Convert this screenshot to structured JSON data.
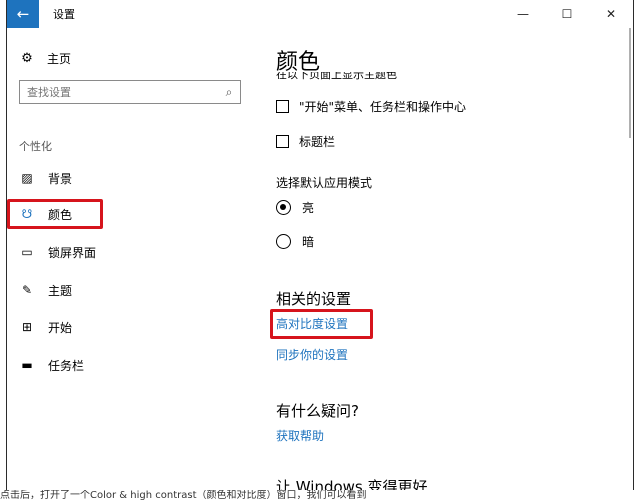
{
  "window": {
    "title": "设置",
    "back_icon": "arrow-left-icon",
    "controls": [
      "—",
      "☐",
      "✕"
    ]
  },
  "sidebar": {
    "home": {
      "label": "主页",
      "icon": "gear-icon"
    },
    "search": {
      "placeholder": "查找设置",
      "icon": "search-icon"
    },
    "section_label": "个性化",
    "items": [
      {
        "label": "背景",
        "icon": "picture-icon"
      },
      {
        "label": "颜色",
        "icon": "palette-icon",
        "active": true
      },
      {
        "label": "锁屏界面",
        "icon": "lock-screen-icon"
      },
      {
        "label": "主题",
        "icon": "theme-brush-icon"
      },
      {
        "label": "开始",
        "icon": "start-grid-icon"
      },
      {
        "label": "任务栏",
        "icon": "taskbar-icon"
      }
    ]
  },
  "main": {
    "title": "颜色",
    "clipped_text": "在以下页面上显示主题色",
    "checkboxes": [
      {
        "label": "\"开始\"菜单、任务栏和操作中心",
        "checked": false
      },
      {
        "label": "标题栏",
        "checked": false
      }
    ],
    "app_mode_heading": "选择默认应用模式",
    "app_modes": [
      {
        "label": "亮",
        "checked": true
      },
      {
        "label": "暗",
        "checked": false
      }
    ],
    "related_heading": "相关的设置",
    "related_links": [
      "高对比度设置",
      "同步你的设置"
    ],
    "question_heading": "有什么疑问?",
    "help_link": "获取帮助",
    "improve_heading": "让 Windows 变得更好"
  },
  "caption": "点击后，打开了一个Color & high contrast（颜色和对比度）窗口，我们可以看到"
}
